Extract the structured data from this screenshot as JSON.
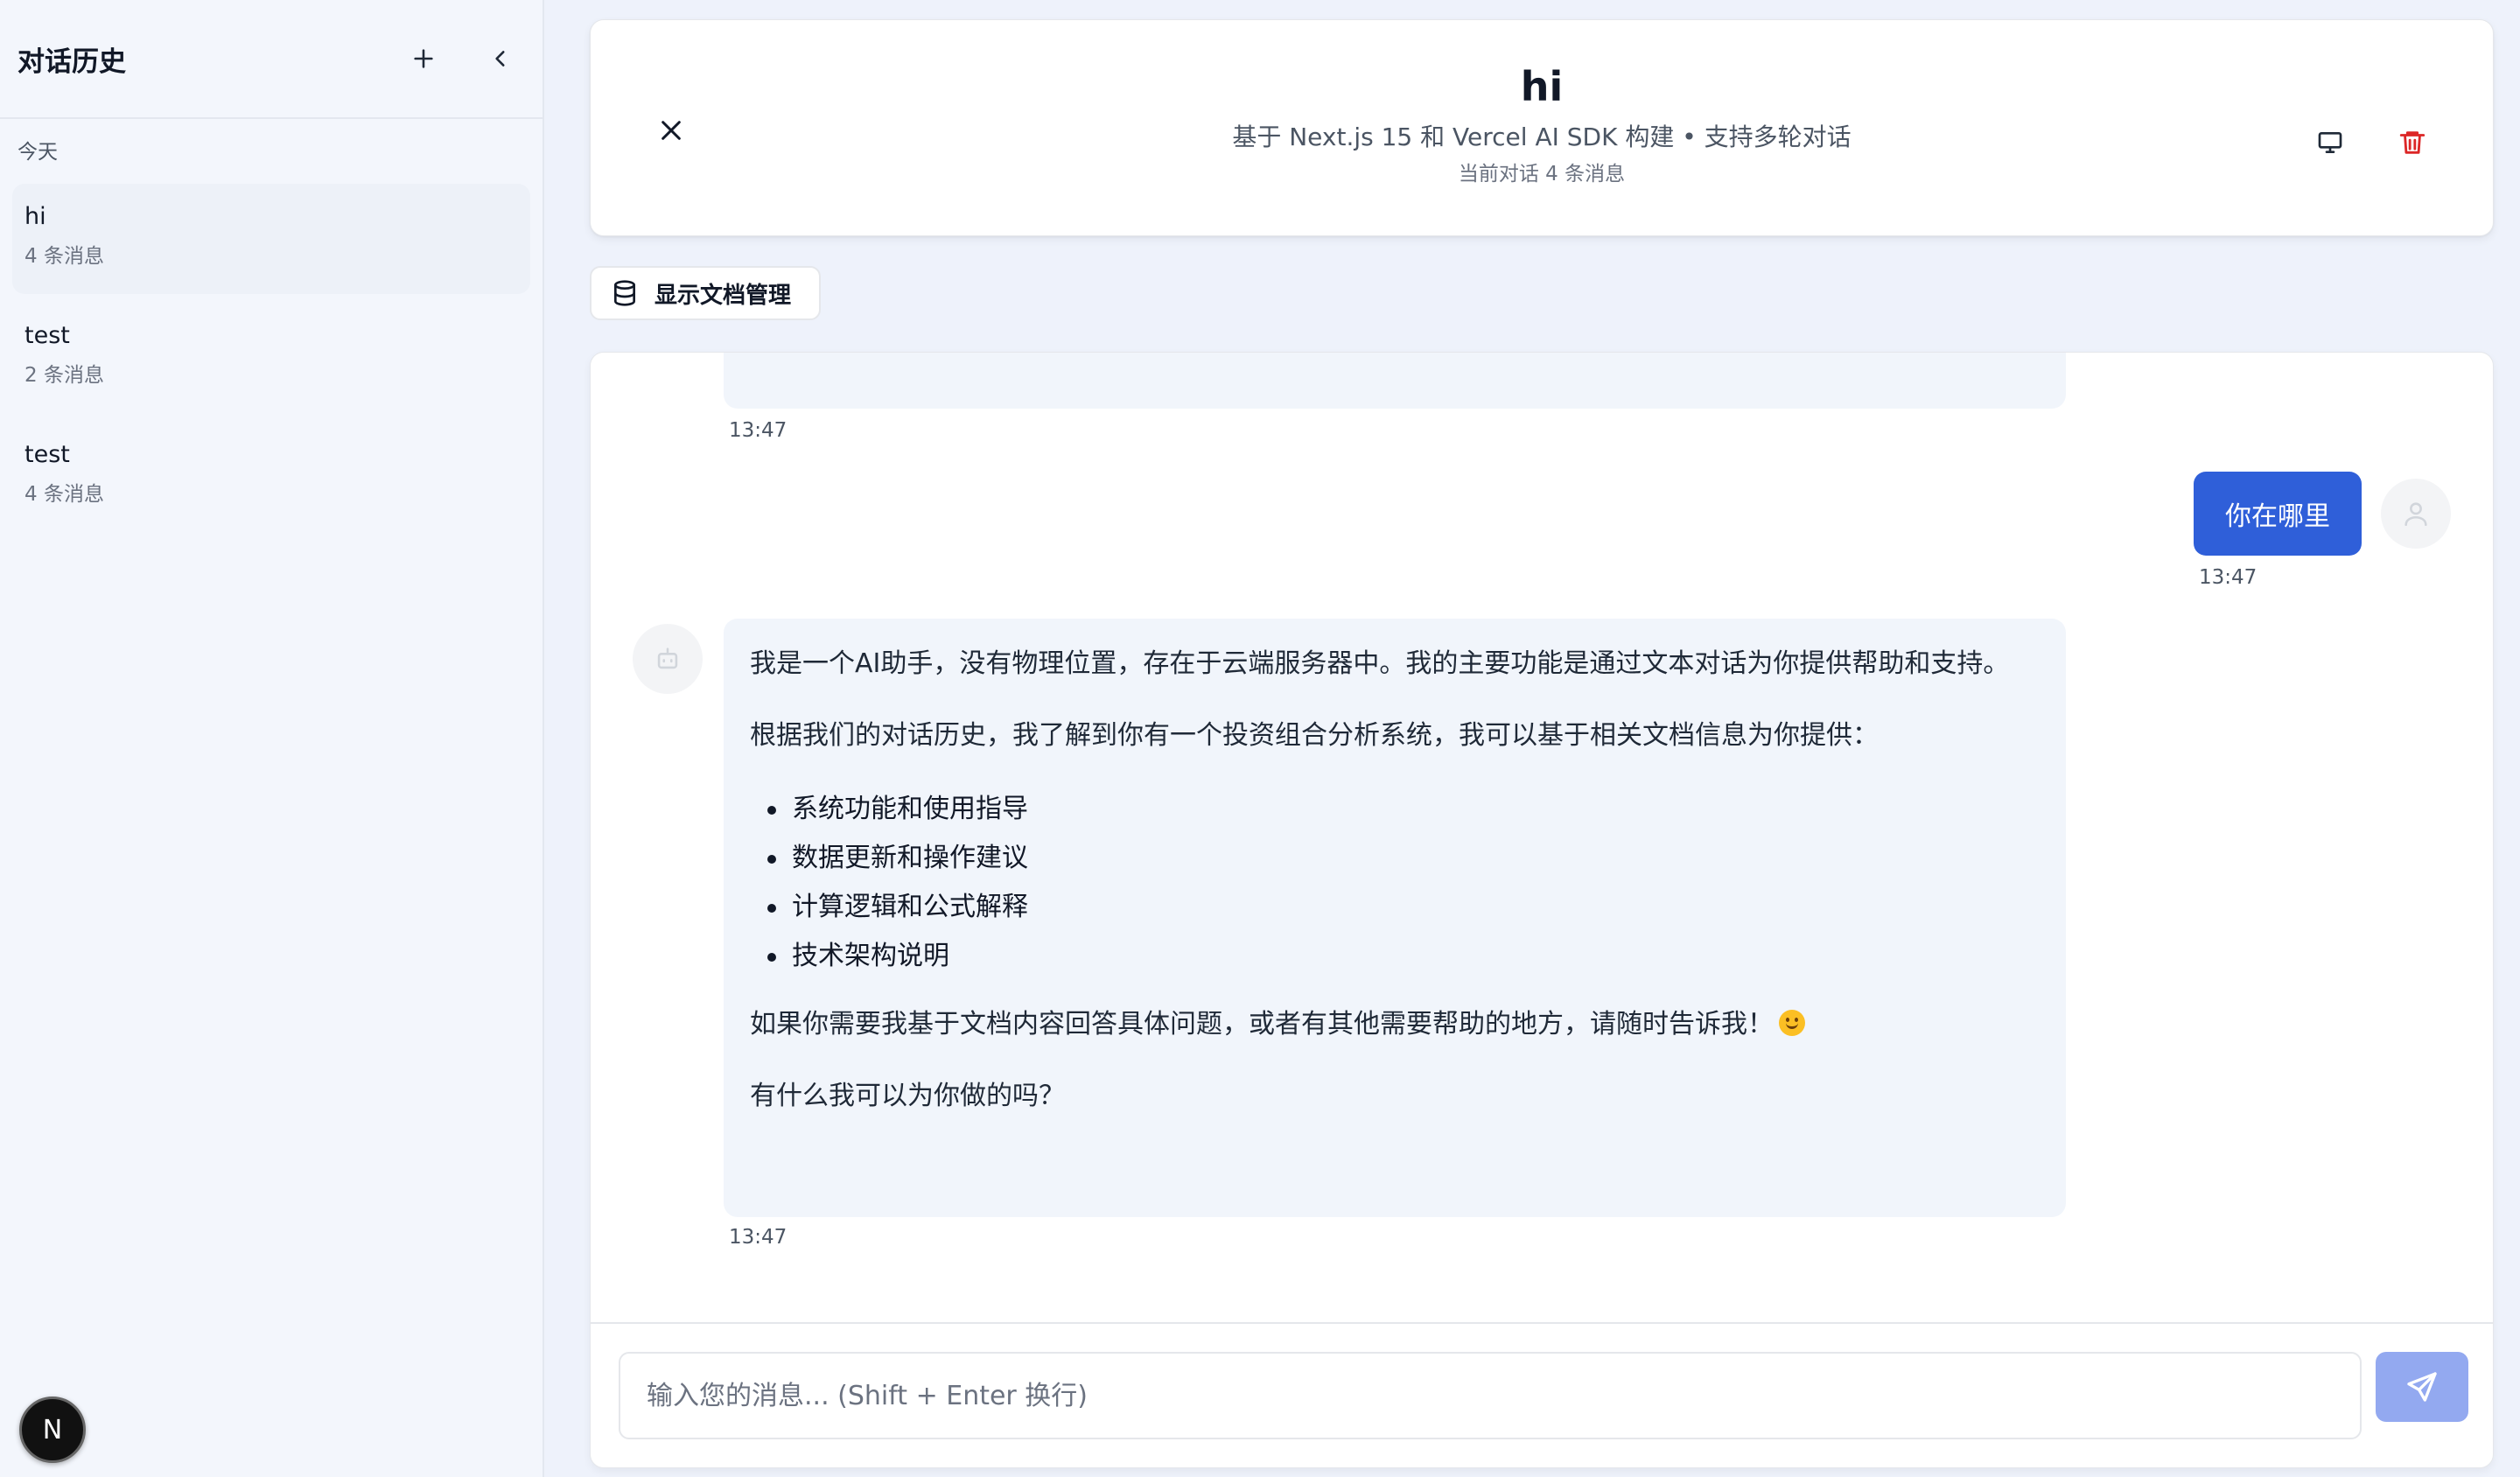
{
  "sidebar": {
    "title": "对话历史",
    "section_label": "今天",
    "items": [
      {
        "title": "hi",
        "subtitle": "4 条消息"
      },
      {
        "title": "test",
        "subtitle": "2 条消息"
      },
      {
        "title": "test",
        "subtitle": "4 条消息"
      }
    ],
    "avatar_letter": "N"
  },
  "header": {
    "title": "hi",
    "subtitle": "基于 Next.js 15 和 Vercel AI SDK 构建 • 支持多轮对话",
    "message_count": "当前对话 4 条消息"
  },
  "doc_button": {
    "label": "显示文档管理"
  },
  "chat": {
    "messages": [
      {
        "role": "assistant",
        "time": "13:47"
      },
      {
        "role": "user",
        "text": "你在哪里",
        "time": "13:47"
      },
      {
        "role": "assistant",
        "paragraph1": "我是一个AI助手，没有物理位置，存在于云端服务器中。我的主要功能是通过文本对话为你提供帮助和支持。",
        "paragraph2": "根据我们的对话历史，我了解到你有一个投资组合分析系统，我可以基于相关文档信息为你提供：",
        "list": [
          "系统功能和使用指导",
          "数据更新和操作建议",
          "计算逻辑和公式解释",
          "技术架构说明"
        ],
        "paragraph3": "如果你需要我基于文档内容回答具体问题，或者有其他需要帮助的地方，请随时告诉我！",
        "paragraph4": "有什么我可以为你做的吗？",
        "time": "13:47"
      }
    ]
  },
  "input": {
    "placeholder": "输入您的消息... (Shift + Enter 换行)",
    "value": ""
  },
  "colors": {
    "accent": "#2f5fd9",
    "send_disabled": "#93a9f0",
    "danger": "#dc2626",
    "bubble_bg": "#f1f5fb"
  }
}
